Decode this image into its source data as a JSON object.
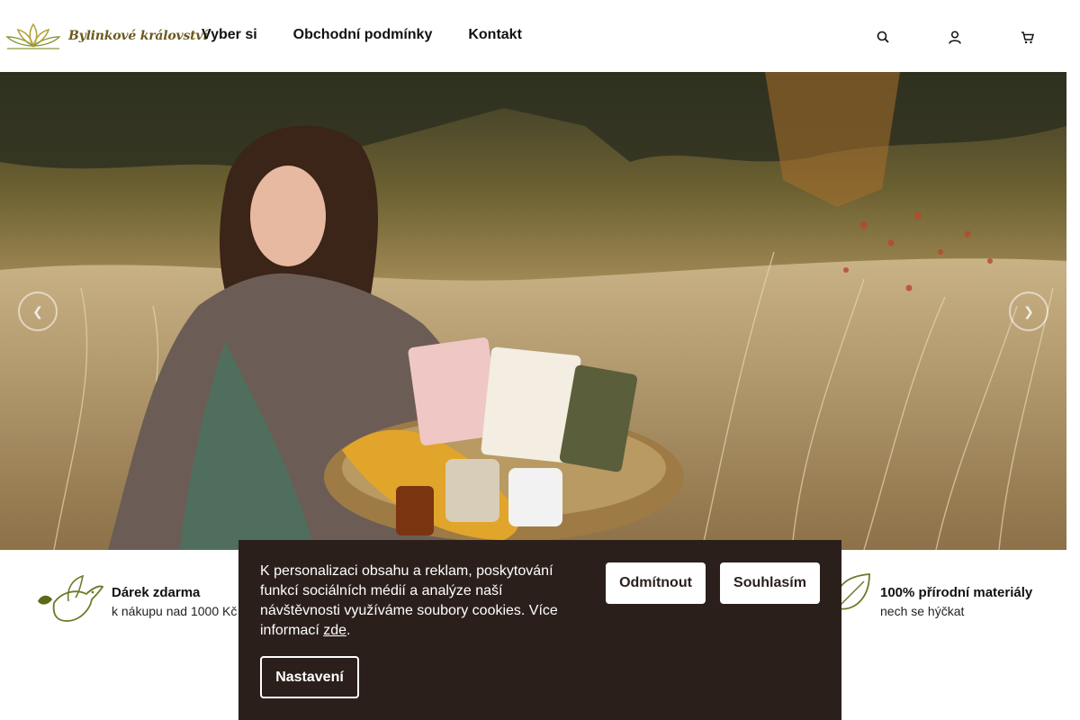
{
  "header": {
    "logo_text": "Bylinkové království",
    "nav": [
      {
        "label": "Vyber si"
      },
      {
        "label": "Obchodní podmínky"
      },
      {
        "label": "Kontakt"
      }
    ],
    "icons": [
      "search-icon",
      "user-icon",
      "cart-icon"
    ]
  },
  "hero": {
    "prev_icon": "chevron-left-icon",
    "next_icon": "chevron-right-icon"
  },
  "benefits": [
    {
      "title": "Dárek zdarma",
      "subtitle": "k nákupu nad 1000 Kč",
      "icon": "dove-icon"
    },
    {
      "title": "100% přírodní materiály",
      "subtitle": "nech se hýčkat",
      "icon": "leaf-icon"
    }
  ],
  "cookie": {
    "text": "K personalizaci obsahu a reklam, poskytování funkcí sociálních médií a analýze naší návštěvnosti využíváme soubory cookies. Více informací ",
    "link": "zde",
    "after_link": ".",
    "decline_label": "Odmítnout",
    "accept_label": "Souhlasím",
    "settings_label": "Nastavení"
  },
  "colors": {
    "cookie_bg": "#2b1f1c",
    "accent": "#6b5a1e"
  }
}
